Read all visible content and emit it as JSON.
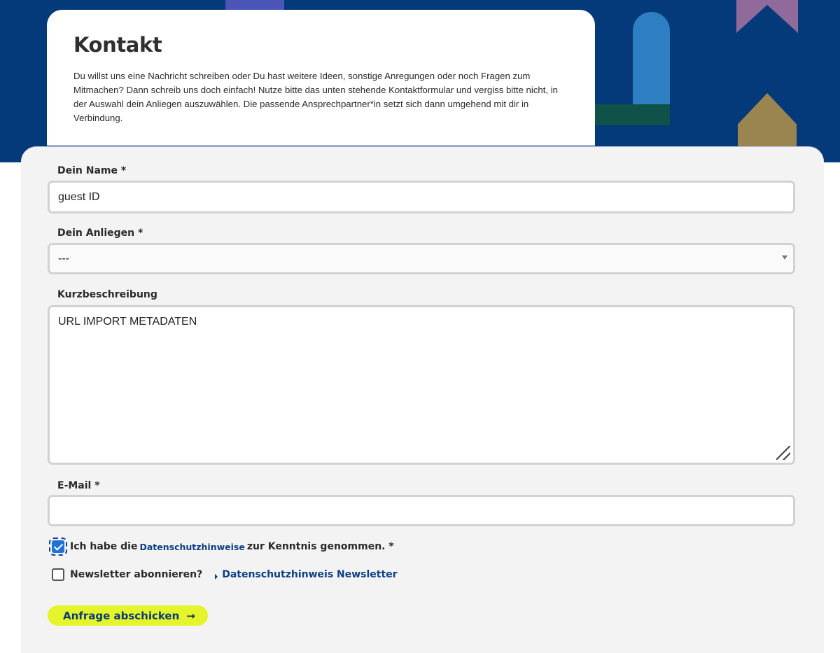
{
  "intro": {
    "title": "Kontakt",
    "text": "Du willst uns eine Nachricht schreiben oder Du hast weitere Ideen, sonstige Anregungen oder noch Fragen zum Mitmachen? Dann schreib uns doch einfach! Nutze bitte das unten stehende Kontaktformular und vergiss bitte nicht, in der Auswahl dein Anliegen auszuwählen. Die passende Ansprechpartner*in setzt sich dann umgehend mit dir in Verbindung."
  },
  "form": {
    "name_label": "Dein Name *",
    "name_value": "guest ID",
    "concern_label": "Dein Anliegen *",
    "concern_selected": "---",
    "description_label": "Kurzbeschreibung",
    "description_value": "URL IMPORT METADATEN",
    "email_label": "E-Mail *",
    "email_value": "",
    "privacy_prefix": "Ich habe die",
    "privacy_link": "Datenschutzhinweise",
    "privacy_suffix": "zur Kenntnis genommen. *",
    "privacy_checked": true,
    "newsletter_label": "Newsletter abonnieren?",
    "newsletter_checked": false,
    "newsletter_link": "Datenschutzhinweis Newsletter",
    "submit_label": "Anfrage abschicken",
    "submit_icon": "arrow-right-icon"
  },
  "colors": {
    "hero_bg": "#053a7a",
    "accent_button": "#e4f52b",
    "link": "#0b3f86",
    "checkbox_checked": "#1f73d8"
  }
}
